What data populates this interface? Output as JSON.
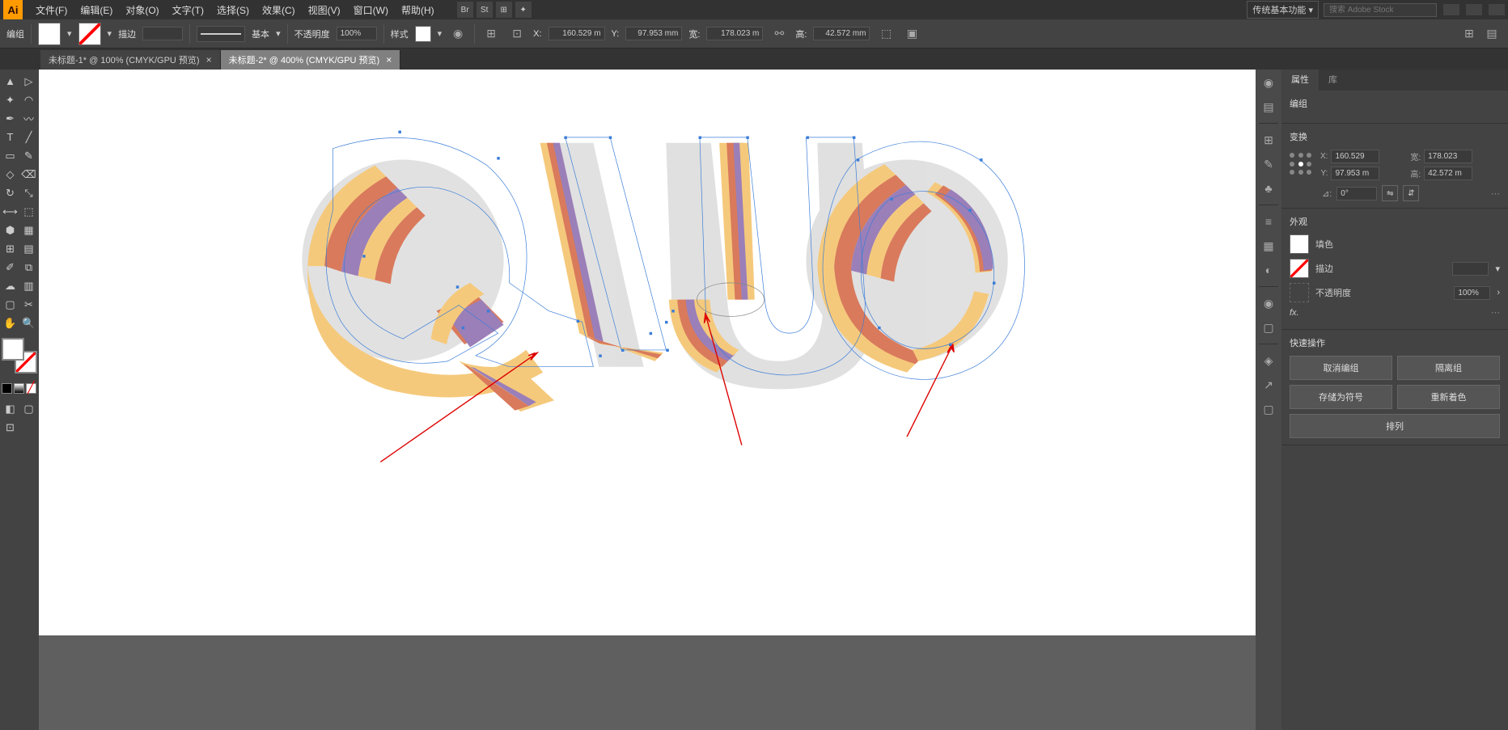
{
  "app": {
    "icon_text": "Ai"
  },
  "menu": {
    "file": "文件(F)",
    "edit": "编辑(E)",
    "object": "对象(O)",
    "text": "文字(T)",
    "select": "选择(S)",
    "effect": "效果(C)",
    "view": "视图(V)",
    "window": "窗口(W)",
    "help": "帮助(H)"
  },
  "menubar_right": {
    "workspace": "传统基本功能",
    "search_placeholder": "搜索 Adobe Stock"
  },
  "controlbar": {
    "selection_label": "编组",
    "stroke_label": "描边",
    "stroke_weight": "",
    "brush_label": "基本",
    "opacity_label": "不透明度",
    "opacity_value": "100%",
    "style_label": "样式",
    "x_label": "X:",
    "x_value": "160.529 m",
    "y_label": "Y:",
    "y_value": "97.953 mm",
    "w_label": "宽:",
    "w_value": "178.023 m",
    "h_label": "高:",
    "h_value": "42.572 mm"
  },
  "tabs": [
    {
      "label": "未标题-1* @ 100% (CMYK/GPU 预览)",
      "active": false
    },
    {
      "label": "未标题-2* @ 400% (CMYK/GPU 预览)",
      "active": true
    }
  ],
  "properties": {
    "tab_properties": "属性",
    "tab_library": "库",
    "selection_type": "编组",
    "transform_heading": "变换",
    "x_label": "X:",
    "x_value": "160.529",
    "w_label": "宽:",
    "w_value": "178.023",
    "y_label": "Y:",
    "y_value": "97.953 m",
    "h_label": "高:",
    "h_value": "42.572 m",
    "rotate_label": "⊿:",
    "rotate_value": "0°",
    "appearance_heading": "外观",
    "fill_label": "填色",
    "stroke_label": "描边",
    "stroke_weight": "",
    "opacity_label": "不透明度",
    "opacity_value": "100%",
    "fx_label": "fx.",
    "quick_actions_heading": "快速操作",
    "ungroup_btn": "取消编组",
    "isolate_btn": "隔离组",
    "save_symbol_btn": "存储为符号",
    "recolor_btn": "重新着色",
    "arrange_btn": "排列"
  },
  "icons": {
    "selection": "▲",
    "direct_select": "▷",
    "magic_wand": "✦",
    "lasso": "⊃",
    "pen": "✒",
    "curve": "〰",
    "type": "T",
    "line": "╱",
    "rect": "▭",
    "brush": "✎",
    "shaper": "◇",
    "eraser": "⌫",
    "rotate": "↻",
    "scale": "⤡",
    "width": "⟷",
    "warp": "▣",
    "free_transform": "⬚",
    "shape_builder": "⬢",
    "perspective": "▦",
    "mesh": "⊞",
    "gradient": "▤",
    "eyedropper": "✐",
    "blend": "⧉",
    "symbol": "☁",
    "graph": "📊",
    "artboard": "▢",
    "slice": "✂",
    "hand": "✋",
    "zoom": "🔍"
  }
}
